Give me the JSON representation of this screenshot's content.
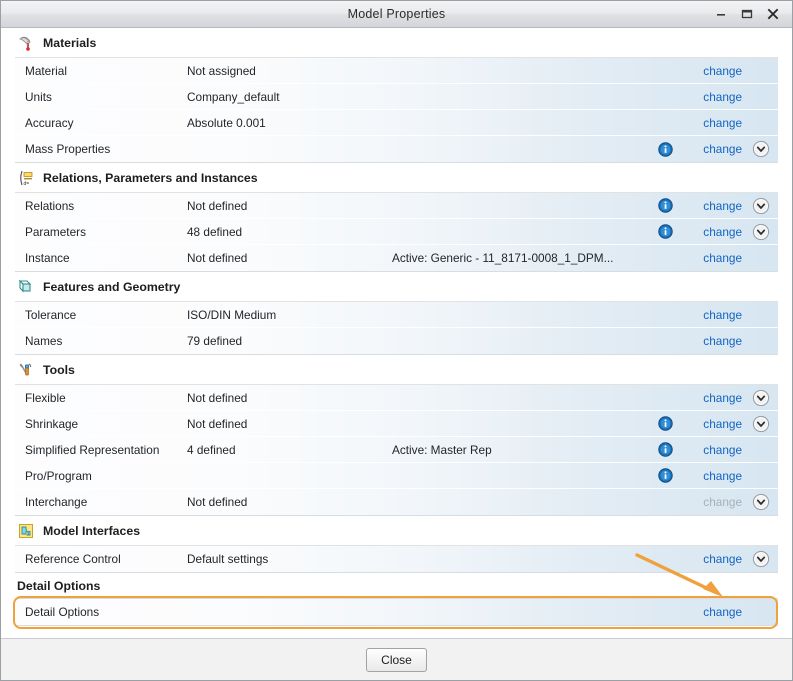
{
  "window": {
    "title": "Model Properties",
    "controls": [
      {
        "name": "minimize",
        "glyph": "–"
      },
      {
        "name": "maximize",
        "glyph": "❐"
      },
      {
        "name": "close",
        "glyph": "✕"
      }
    ]
  },
  "colors": {
    "link": "#1364c4",
    "link_disabled": "#a8b0b8",
    "highlight_border": "#f0a03c",
    "row_gradient_start": "#fdfdfe",
    "row_gradient_end": "#d7e6f1",
    "titlebar": "#e9eaec",
    "footer": "#f2f2f2"
  },
  "sections": [
    {
      "id": "materials",
      "label": "Materials",
      "icon": "materials-icon",
      "rows": [
        {
          "label": "Material",
          "value": "Not assigned",
          "extra": "",
          "info": false,
          "change": "change",
          "change_enabled": true,
          "chevron": false
        },
        {
          "label": "Units",
          "value": "Company_default",
          "extra": "",
          "info": false,
          "change": "change",
          "change_enabled": true,
          "chevron": false
        },
        {
          "label": "Accuracy",
          "value": "Absolute 0.001",
          "extra": "",
          "info": false,
          "change": "change",
          "change_enabled": true,
          "chevron": false
        },
        {
          "label": "Mass Properties",
          "value": "",
          "extra": "",
          "info": true,
          "change": "change",
          "change_enabled": true,
          "chevron": true
        }
      ]
    },
    {
      "id": "relations",
      "label": "Relations, Parameters and Instances",
      "icon": "relations-icon",
      "rows": [
        {
          "label": "Relations",
          "value": "Not defined",
          "extra": "",
          "info": true,
          "change": "change",
          "change_enabled": true,
          "chevron": true
        },
        {
          "label": "Parameters",
          "value": "48 defined",
          "extra": "",
          "info": true,
          "change": "change",
          "change_enabled": true,
          "chevron": true
        },
        {
          "label": "Instance",
          "value": "Not defined",
          "extra": "Active: Generic - 11_8171-0008_1_DPM...",
          "info": false,
          "change": "change",
          "change_enabled": true,
          "chevron": false
        }
      ]
    },
    {
      "id": "features",
      "label": "Features and Geometry",
      "icon": "features-icon",
      "rows": [
        {
          "label": "Tolerance",
          "value": "ISO/DIN Medium",
          "extra": "",
          "info": false,
          "change": "change",
          "change_enabled": true,
          "chevron": false
        },
        {
          "label": "Names",
          "value": "79 defined",
          "extra": "",
          "info": false,
          "change": "change",
          "change_enabled": true,
          "chevron": false
        }
      ]
    },
    {
      "id": "tools",
      "label": "Tools",
      "icon": "tools-icon",
      "rows": [
        {
          "label": "Flexible",
          "value": "Not defined",
          "extra": "",
          "info": false,
          "change": "change",
          "change_enabled": true,
          "chevron": true
        },
        {
          "label": "Shrinkage",
          "value": "Not defined",
          "extra": "",
          "info": true,
          "change": "change",
          "change_enabled": true,
          "chevron": true
        },
        {
          "label": "Simplified Representation",
          "value": "4 defined",
          "extra": "Active: Master Rep",
          "info": true,
          "change": "change",
          "change_enabled": true,
          "chevron": false
        },
        {
          "label": "Pro/Program",
          "value": "",
          "extra": "",
          "info": true,
          "change": "change",
          "change_enabled": true,
          "chevron": false
        },
        {
          "label": "Interchange",
          "value": "Not defined",
          "extra": "",
          "info": false,
          "change": "change",
          "change_enabled": false,
          "chevron": true
        }
      ]
    },
    {
      "id": "model-interfaces",
      "label": "Model Interfaces",
      "icon": "model-interfaces-icon",
      "rows": [
        {
          "label": "Reference Control",
          "value": "Default settings",
          "extra": "",
          "info": false,
          "change": "change",
          "change_enabled": true,
          "chevron": true
        }
      ]
    },
    {
      "id": "detail-options",
      "label": "Detail Options",
      "icon": null,
      "highlighted": true,
      "rows": [
        {
          "label": "Detail Options",
          "value": "",
          "extra": "",
          "info": false,
          "change": "change",
          "change_enabled": true,
          "chevron": false
        }
      ]
    }
  ],
  "annotation": {
    "type": "arrow",
    "color": "#f0a03c",
    "points_to": "detail-options-change-link"
  },
  "footer": {
    "close_label": "Close"
  }
}
